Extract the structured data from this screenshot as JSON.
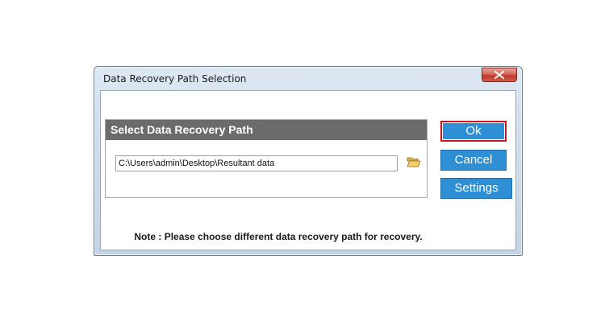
{
  "window": {
    "title": "Data Recovery Path Selection",
    "close_icon": "close-x-icon"
  },
  "group": {
    "header": "Select Data Recovery Path",
    "path_value": "C:\\Users\\admin\\Desktop\\Resultant data",
    "folder_icon": "open-folder-icon"
  },
  "buttons": {
    "ok_label": "Ok",
    "cancel_label": "Cancel",
    "settings_label": "Settings"
  },
  "note": "Note : Please choose different data recovery path for recovery.",
  "colors": {
    "button_blue": "#2e8fd4",
    "focus_red": "#d0141e",
    "header_gray": "#6b6b6b",
    "close_red": "#c1392b"
  }
}
